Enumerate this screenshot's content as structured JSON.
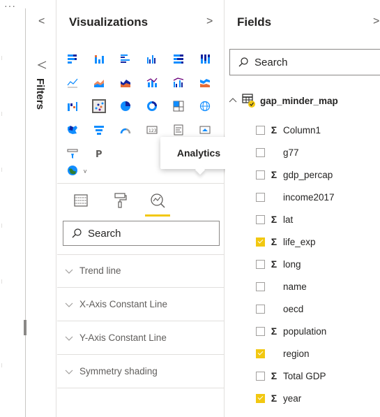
{
  "rail": {
    "more_label": "···"
  },
  "filters": {
    "label": "Filters",
    "collapse_glyph": "<"
  },
  "visualizations": {
    "title": "Visualizations",
    "expand_glyph": ">",
    "tooltip": "Analytics",
    "search": {
      "placeholder": "Search",
      "value": ""
    },
    "selected_visual": "scatter-chart",
    "visual_icons": [
      [
        "stacked-bar-icon",
        "stacked-column-icon",
        "clustered-bar-icon",
        "clustered-column-icon",
        "100-stacked-bar-icon",
        "100-stacked-column-icon"
      ],
      [
        "line-chart-icon",
        "area-chart-icon",
        "stacked-area-icon",
        "line-column-icon",
        "line-clustered-column-icon",
        "ribbon-chart-icon"
      ],
      [
        "waterfall-icon",
        "scatter-chart-icon",
        "pie-chart-icon",
        "donut-chart-icon",
        "treemap-icon",
        "map-icon"
      ],
      [
        "filled-map-icon",
        "funnel-chart-icon",
        "gauge-icon",
        "card-icon",
        "multi-row-card-icon",
        "kpi-icon"
      ],
      [
        "slicer-icon",
        "python-visual-icon",
        "",
        "",
        "r-visual-icon",
        "decomposition-tree-icon"
      ],
      [
        "arcgis-map-icon",
        "key-influencers-icon"
      ]
    ],
    "pane_tabs": [
      {
        "name": "fields-tab",
        "icon": "fields-well-icon"
      },
      {
        "name": "format-tab",
        "icon": "paint-roller-icon"
      },
      {
        "name": "analytics-tab",
        "icon": "analytics-magnifier-icon",
        "active": true
      }
    ],
    "analytics_sections": [
      "Trend line",
      "X-Axis Constant Line",
      "Y-Axis Constant Line",
      "Symmetry shading"
    ]
  },
  "fields": {
    "title": "Fields",
    "expand_glyph": ">",
    "search": {
      "placeholder": "Search",
      "value": ""
    },
    "table_name": "gap_minder_map",
    "items": [
      {
        "name": "Column1",
        "sigma": true,
        "checked": false
      },
      {
        "name": "g77",
        "sigma": false,
        "checked": false
      },
      {
        "name": "gdp_percap",
        "sigma": true,
        "checked": false
      },
      {
        "name": "income2017",
        "sigma": false,
        "checked": false
      },
      {
        "name": "lat",
        "sigma": true,
        "checked": false
      },
      {
        "name": "life_exp",
        "sigma": true,
        "checked": true
      },
      {
        "name": "long",
        "sigma": true,
        "checked": false
      },
      {
        "name": "name",
        "sigma": false,
        "checked": false
      },
      {
        "name": "oecd",
        "sigma": false,
        "checked": false
      },
      {
        "name": "population",
        "sigma": true,
        "checked": false
      },
      {
        "name": "region",
        "sigma": false,
        "checked": true
      },
      {
        "name": "Total GDP",
        "sigma": true,
        "checked": false
      },
      {
        "name": "year",
        "sigma": true,
        "checked": true
      }
    ]
  },
  "colors": {
    "accent": "#f2c811",
    "blue": "#118dff",
    "dark_blue": "#12239e",
    "orange": "#e66c37",
    "purple": "#6b007b",
    "text": "#252423",
    "muted": "#605e5c"
  }
}
